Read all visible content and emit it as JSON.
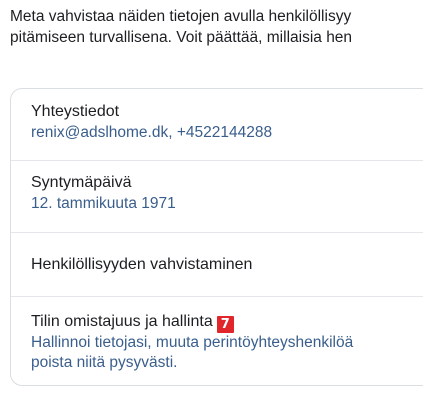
{
  "intro": {
    "line1": "Meta vahvistaa näiden tietojen avulla henkilöllisyy",
    "line2": "pitämiseen turvallisena. Voit päättää, millaisia hen"
  },
  "sections": [
    {
      "title": "Yhteystiedot",
      "subtitle": "renix@adslhome.dk, +4522144288"
    },
    {
      "title": "Syntymäpäivä",
      "subtitle": "12. tammikuuta 1971"
    },
    {
      "title": "Henkilöllisyyden vahvistaminen"
    },
    {
      "title": "Tilin omistajuus ja hallinta",
      "badge": "7",
      "subtitle_line1": "Hallinnoi tietojasi, muuta perintöyhteyshenkilöä",
      "subtitle_line2": "poista niitä pysyvästi."
    }
  ],
  "colors": {
    "link_text": "#3a5e8c",
    "badge_bg": "#e0262b",
    "border": "#dadde1"
  }
}
